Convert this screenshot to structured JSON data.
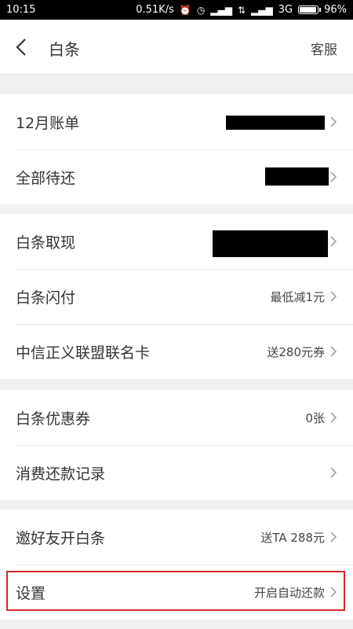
{
  "status_bar": {
    "time": "10:15",
    "speed": "0.51K/s",
    "network": "3G",
    "battery": "96%",
    "battery_level": 0.96
  },
  "header": {
    "title": "白条",
    "service": "客服",
    "back_icon": "chevron-left-icon"
  },
  "rows": [
    {
      "label": "12月账单",
      "value": "",
      "redacted": true
    },
    {
      "label": "全部待还",
      "value": "",
      "redacted": true
    },
    {
      "label": "白条取现",
      "value": "",
      "redacted": true
    },
    {
      "label": "白条闪付",
      "value": "最低减1元"
    },
    {
      "label": "中信正义联盟联名卡",
      "value": "送280元券"
    },
    {
      "label": "白条优惠券",
      "value": "0张"
    },
    {
      "label": "消费还款记录",
      "value": ""
    },
    {
      "label": "邀好友开白条",
      "value": "送TA 288元"
    },
    {
      "label": "设置",
      "value": "开启自动还款",
      "highlighted": true
    }
  ],
  "colors": {
    "highlight_border": "#d9262b",
    "background": "#f0f0f0"
  }
}
